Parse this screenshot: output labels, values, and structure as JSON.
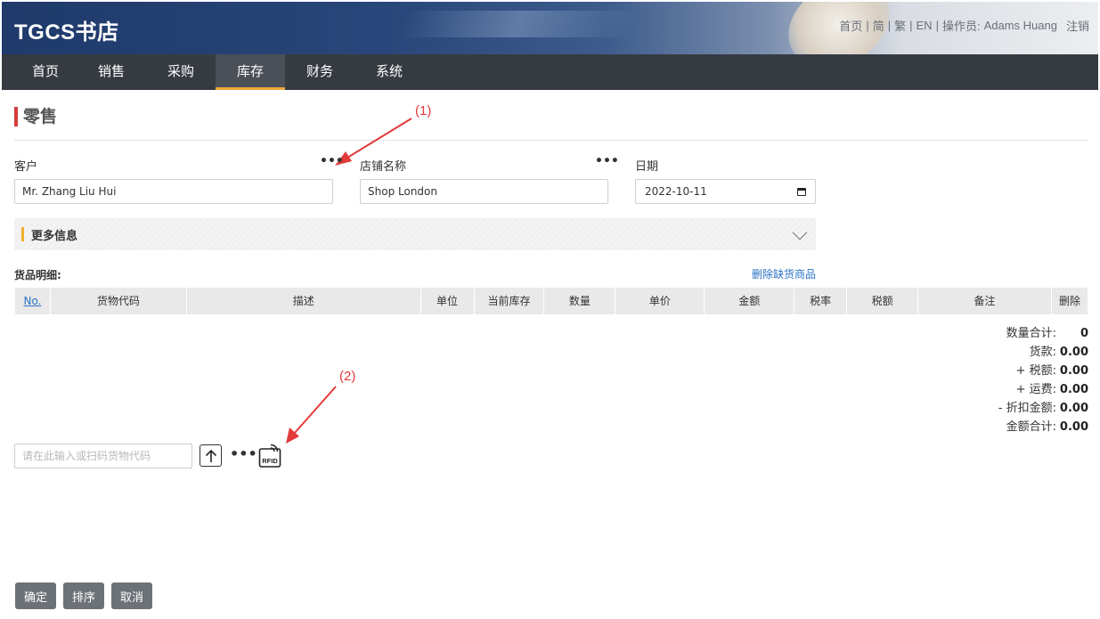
{
  "app": {
    "logo": "TGCS书店"
  },
  "top_menu": {
    "home": "首页",
    "simplified": "简",
    "traditional": "繁",
    "english": "EN",
    "operator_label": "操作员:",
    "operator_name": "Adams Huang",
    "logout": "注销",
    "separator": "|"
  },
  "nav": {
    "items": [
      {
        "label": "首页"
      },
      {
        "label": "销售"
      },
      {
        "label": "采购"
      },
      {
        "label": "库存",
        "active": true
      },
      {
        "label": "财务"
      },
      {
        "label": "系统"
      }
    ],
    "active_color": "#e9a83a"
  },
  "page": {
    "title": "零售",
    "title_accent": "#d63b3b"
  },
  "annotations": {
    "a1": "(1)",
    "a2": "(2)",
    "color": "#e23a3a"
  },
  "form": {
    "customer": {
      "label": "客户",
      "value": "Mr. Zhang Liu Hui",
      "more": "•••"
    },
    "store": {
      "label": "店铺名称",
      "value": "Shop London",
      "more": "•••"
    },
    "date": {
      "label": "日期",
      "value": "2022-10-11"
    }
  },
  "more_info": {
    "label": "更多信息"
  },
  "items_section": {
    "label": "货品明细:",
    "remove_out_of_stock": "删除缺货商品",
    "columns": [
      "No.",
      "货物代码",
      "描述",
      "单位",
      "当前库存",
      "数量",
      "单价",
      "金额",
      "税率",
      "税额",
      "备注",
      "删除"
    ]
  },
  "totals": {
    "qty_label": "数量合计:",
    "qty_value": "0",
    "goods_label": "货款:",
    "goods_value": "0.00",
    "tax_label": "+ 税额:",
    "tax_value": "0.00",
    "shipping_label": "+ 运费:",
    "shipping_value": "0.00",
    "discount_label": "- 折扣金额:",
    "discount_value": "0.00",
    "total_label": "金额合计:",
    "total_value": "0.00"
  },
  "scan": {
    "placeholder": "请在此输入或扫码货物代码",
    "more": "•••",
    "rfid_label": "RFID"
  },
  "buttons": {
    "confirm": "确定",
    "sort": "排序",
    "cancel": "取消"
  },
  "icons": {
    "upload": "arrow-up-icon",
    "rfid": "rfid-icon",
    "calendar": "calendar-icon",
    "chevron": "chevron-down-icon"
  }
}
